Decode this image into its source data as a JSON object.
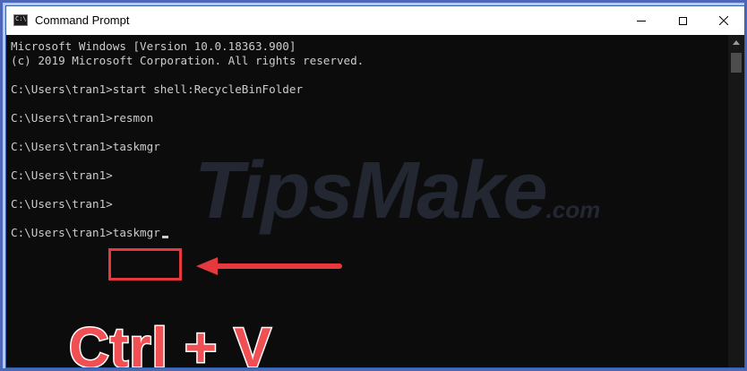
{
  "window": {
    "title": "Command Prompt",
    "icon": "console-icon",
    "icon_glyph": "C:\\",
    "controls": {
      "minimize": "minimize-icon",
      "maximize": "maximize-icon",
      "close": "close-icon"
    }
  },
  "console": {
    "lines": [
      "Microsoft Windows [Version 10.0.18363.900]",
      "(c) 2019 Microsoft Corporation. All rights reserved.",
      "",
      "C:\\Users\\tran1>start shell:RecycleBinFolder",
      "",
      "C:\\Users\\tran1>resmon",
      "",
      "C:\\Users\\tran1>taskmgr",
      "",
      "C:\\Users\\tran1>",
      "",
      "C:\\Users\\tran1>",
      "",
      "C:\\Users\\tran1>taskmgr"
    ],
    "text_color": "#cccccc",
    "background": "#0c0c0c"
  },
  "overlay": {
    "watermark_main": "TipsMake",
    "watermark_suffix": ".com",
    "label": "Ctrl + V",
    "accent_color": "#e6393d"
  },
  "scrollbar": {
    "up_icon": "scroll-up-arrow-icon"
  }
}
